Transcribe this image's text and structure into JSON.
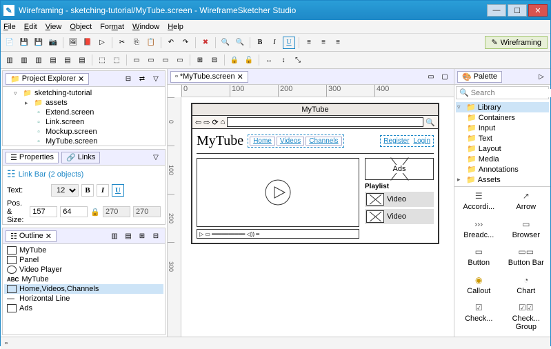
{
  "window": {
    "title": "Wireframing - sketching-tutorial/MyTube.screen - WireframeSketcher Studio"
  },
  "menu": {
    "file": "File",
    "edit": "Edit",
    "view": "View",
    "object": "Object",
    "format": "Format",
    "window": "Window",
    "help": "Help"
  },
  "perspective": "Wireframing",
  "explorer": {
    "title": "Project Explorer",
    "root": "sketching-tutorial",
    "items": [
      "assets",
      "Extend.screen",
      "Link.screen",
      "Mockup.screen",
      "MyTube.screen"
    ]
  },
  "properties": {
    "tab1": "Properties",
    "tab2": "Links",
    "heading": "Link Bar (2 objects)",
    "text_label": "Text:",
    "fontsize": "12",
    "pos_label": "Pos. & Size:",
    "x": "157",
    "y": "64",
    "w": "270",
    "h": "270"
  },
  "outline": {
    "title": "Outline",
    "items": [
      "MyTube",
      "Panel",
      "Video Player",
      "MyTube",
      "Home,Videos,Channels",
      "Horizontal Line",
      "Ads"
    ]
  },
  "editor": {
    "tab": "*MyTube.screen",
    "ruler_h": [
      "0",
      "100",
      "200",
      "300",
      "400"
    ],
    "ruler_v": [
      "0",
      "100",
      "200",
      "300"
    ]
  },
  "mock": {
    "title": "MyTube",
    "brand": "MyTube",
    "nav": [
      "Home",
      "Videos",
      "Channels"
    ],
    "rnav": [
      "Register",
      "Login"
    ],
    "ads": "Ads",
    "playlist": "Playlist",
    "video": "Video"
  },
  "palette": {
    "title": "Palette",
    "search": "Search",
    "root": "Library",
    "cats": [
      "Containers",
      "Input",
      "Text",
      "Layout",
      "Media",
      "Annotations",
      "Assets"
    ],
    "items": [
      "Accordi...",
      "Arrow",
      "Breadc...",
      "Browser",
      "Button",
      "Button Bar",
      "Callout",
      "Chart",
      "Check...",
      "Check... Group"
    ]
  }
}
